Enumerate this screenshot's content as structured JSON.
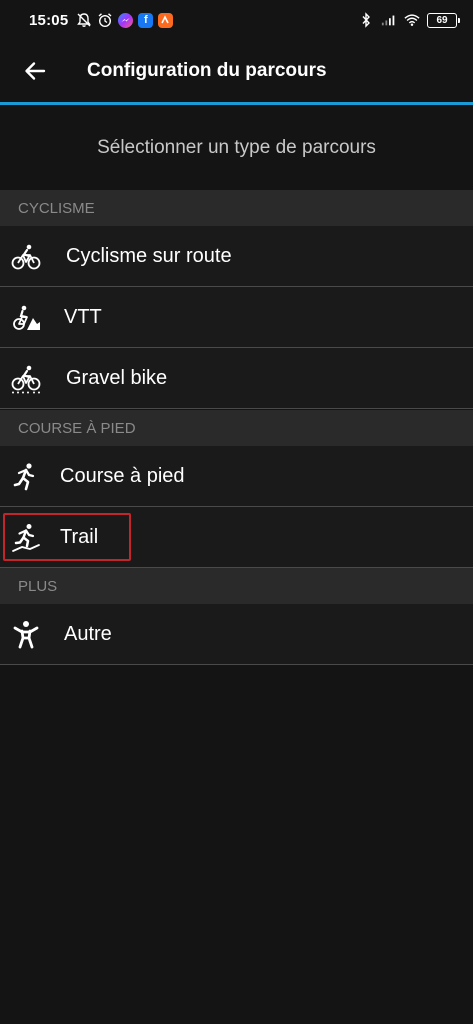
{
  "status_bar": {
    "time": "15:05",
    "battery_level": "69",
    "left_icons": [
      "notifications-off-icon",
      "alarm-icon",
      "messenger-icon",
      "facebook-icon",
      "strava-icon"
    ],
    "right_icons": [
      "bluetooth-icon",
      "signal-icon",
      "wifi-icon",
      "battery-icon"
    ],
    "colors": {
      "messenger": "#a334fa",
      "facebook": "#1877f2",
      "strava": "#fc6a20"
    }
  },
  "app_bar": {
    "back_icon": "arrow-left-icon",
    "title": "Configuration du parcours"
  },
  "accent_color": "#1a9ad6",
  "prompt": "Sélectionner un type de parcours",
  "sections": [
    {
      "header": "CYCLISME",
      "items": [
        {
          "label": "Cyclisme sur route",
          "icon": "road-bike-icon"
        },
        {
          "label": "VTT",
          "icon": "mountain-bike-icon"
        },
        {
          "label": "Gravel bike",
          "icon": "gravel-bike-icon"
        }
      ]
    },
    {
      "header": "COURSE À PIED",
      "items": [
        {
          "label": "Course à pied",
          "icon": "running-icon"
        },
        {
          "label": "Trail",
          "icon": "trail-running-icon",
          "highlighted": true
        }
      ]
    },
    {
      "header": "PLUS",
      "items": [
        {
          "label": "Autre",
          "icon": "person-icon"
        }
      ]
    }
  ],
  "highlight_color": "#c0262b"
}
